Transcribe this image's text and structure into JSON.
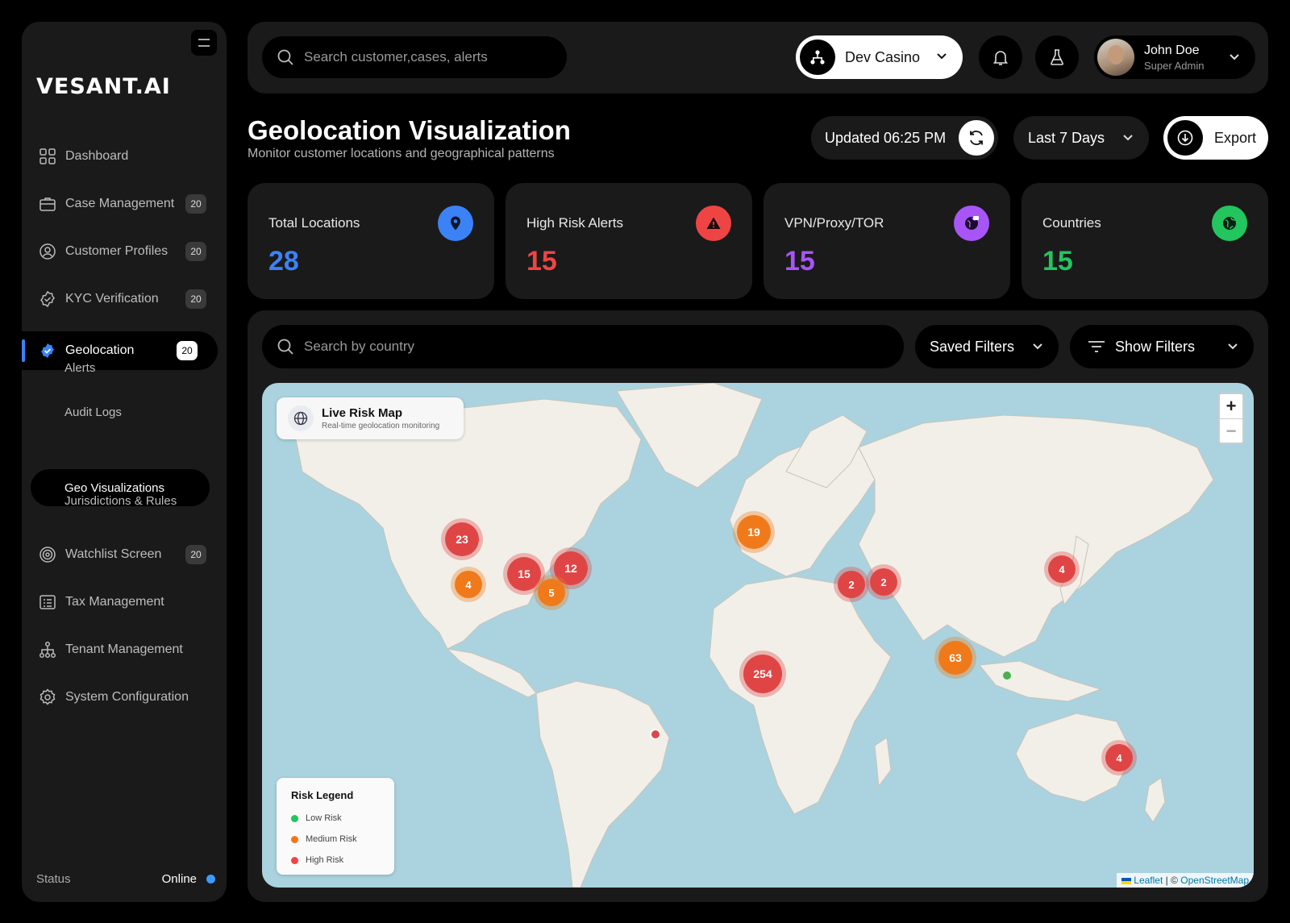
{
  "brand": {
    "logo": "VESANT.AI"
  },
  "sidebar": {
    "items": [
      {
        "label": "Dashboard",
        "badge": ""
      },
      {
        "label": "Case Management",
        "badge": "20"
      },
      {
        "label": "Customer Profiles",
        "badge": "20"
      },
      {
        "label": "KYC Verification",
        "badge": "20"
      },
      {
        "label": "Geolocation",
        "badge": "20"
      },
      {
        "label": "Watchlist Screen",
        "badge": "20"
      },
      {
        "label": "Tax Management",
        "badge": ""
      },
      {
        "label": "Tenant Management",
        "badge": ""
      },
      {
        "label": "System Configuration",
        "badge": ""
      }
    ],
    "subitems": [
      {
        "label": "Alerts"
      },
      {
        "label": "Audit Logs"
      },
      {
        "label": "Geo Visualizations"
      },
      {
        "label": "Jurisdictions & Rules"
      }
    ],
    "status": {
      "label": "Status",
      "value": "Online"
    }
  },
  "topbar": {
    "search_placeholder": "Search customer,cases, alerts",
    "tenant": "Dev Casino",
    "user": {
      "name": "John Doe",
      "role": "Super Admin"
    }
  },
  "page": {
    "title": "Geolocation Visualization",
    "subtitle": "Monitor customer locations and geographical patterns",
    "updated": "Updated 06:25 PM",
    "range": "Last 7 Days",
    "export": "Export"
  },
  "stats": [
    {
      "label": "Total Locations",
      "value": "28",
      "color": "#3b82f6"
    },
    {
      "label": "High Risk Alerts",
      "value": "15",
      "color": "#ef4444"
    },
    {
      "label": "VPN/Proxy/TOR",
      "value": "15",
      "color": "#a855f7"
    },
    {
      "label": "Countries",
      "value": "15",
      "color": "#22c55e"
    }
  ],
  "filters": {
    "search_placeholder": "Search by country",
    "saved": "Saved Filters",
    "show": "Show Filters"
  },
  "map": {
    "title": "Live Risk Map",
    "subtitle": "Real-time geolocation monitoring",
    "zoom_in": "+",
    "zoom_out": "−",
    "legend": {
      "title": "Risk Legend",
      "items": [
        {
          "label": "Low Risk",
          "color": "#22c55e"
        },
        {
          "label": "Medium Risk",
          "color": "#f97316"
        },
        {
          "label": "High Risk",
          "color": "#ef4444"
        }
      ]
    },
    "attribution_a": "Leaflet",
    "attribution_b": "OpenStreetMap",
    "clusters": [
      {
        "count": "23",
        "risk": "high"
      },
      {
        "count": "4",
        "risk": "medium"
      },
      {
        "count": "15",
        "risk": "high"
      },
      {
        "count": "12",
        "risk": "high"
      },
      {
        "count": "5",
        "risk": "medium"
      },
      {
        "count": "19",
        "risk": "medium"
      },
      {
        "count": "2",
        "risk": "high"
      },
      {
        "count": "2",
        "risk": "high"
      },
      {
        "count": "4",
        "risk": "high"
      },
      {
        "count": "63",
        "risk": "medium"
      },
      {
        "count": "254",
        "risk": "high"
      },
      {
        "count": "4",
        "risk": "high"
      },
      {
        "count": "",
        "risk": "high"
      },
      {
        "count": "",
        "risk": "low"
      }
    ]
  }
}
